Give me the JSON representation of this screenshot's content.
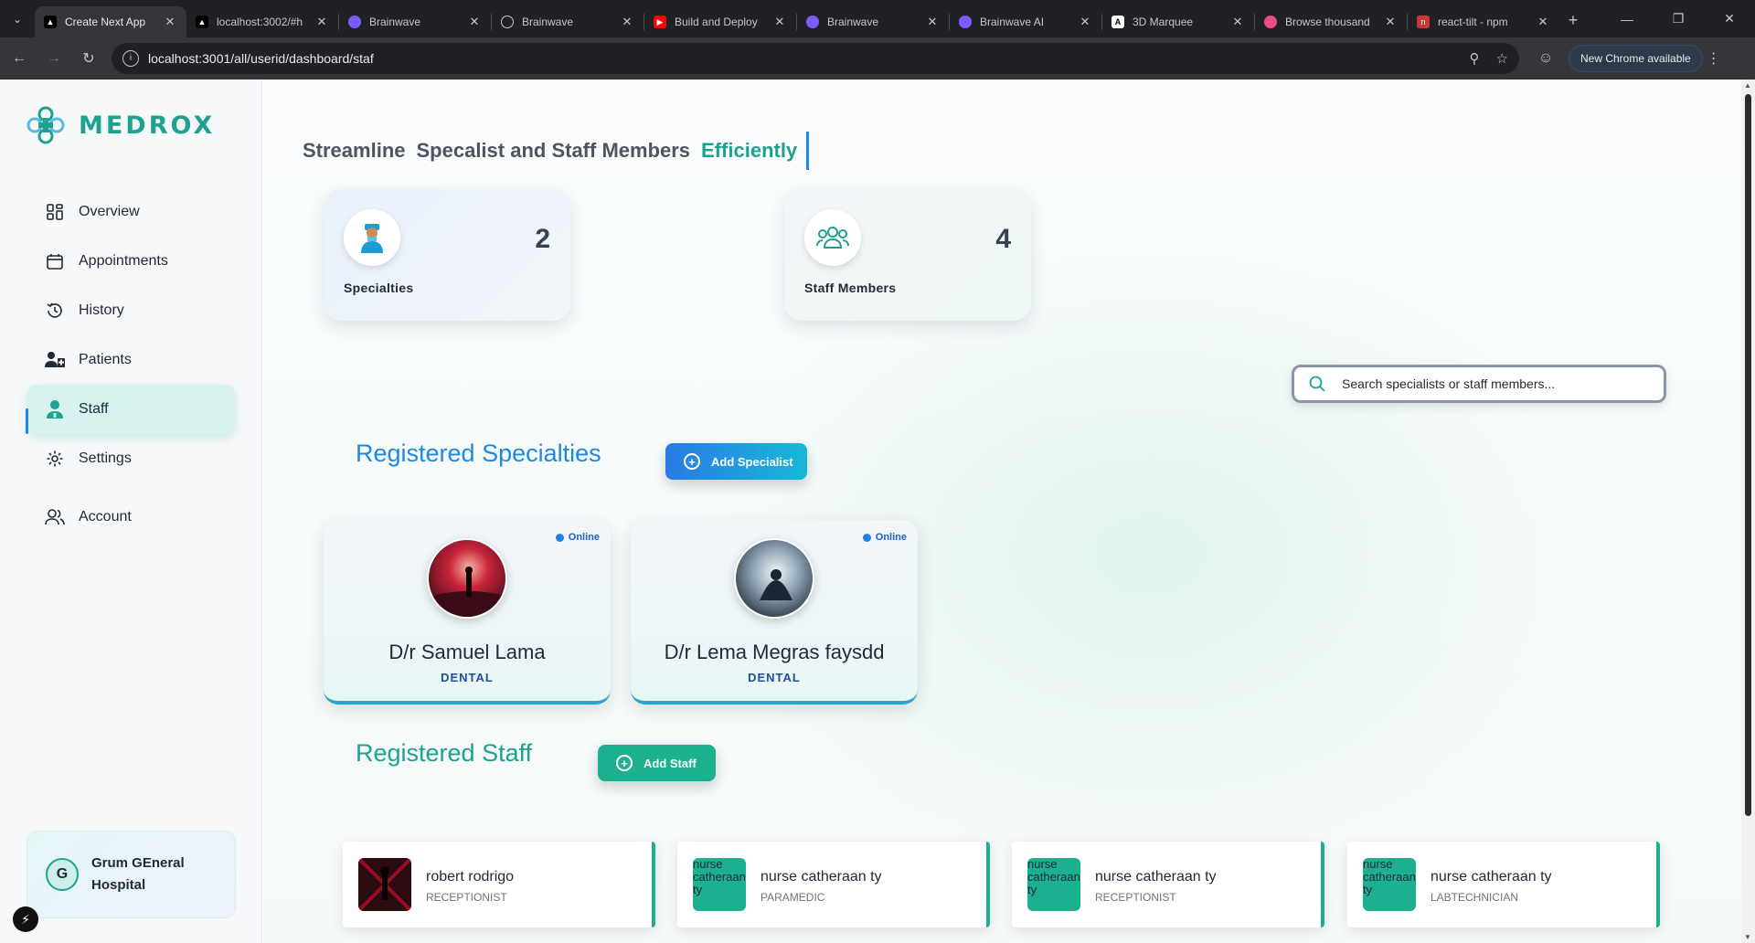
{
  "browser": {
    "tabs": [
      {
        "title": "Create Next App",
        "icon": "nextjs-icon",
        "color": "#000000",
        "active": true
      },
      {
        "title": "localhost:3002/#h",
        "icon": "nextjs-icon",
        "color": "#000000"
      },
      {
        "title": "Brainwave",
        "icon": "brainwave-icon",
        "color": "#7c5cff"
      },
      {
        "title": "Brainwave",
        "icon": "globe-icon",
        "color": "#5f6368"
      },
      {
        "title": "Build and Deploy",
        "icon": "youtube-icon",
        "color": "#ff0000"
      },
      {
        "title": "Brainwave",
        "icon": "brainwave-icon",
        "color": "#7c5cff"
      },
      {
        "title": "Brainwave AI",
        "icon": "brainwave-icon",
        "color": "#7c5cff"
      },
      {
        "title": "3D Marquee",
        "icon": "aceternity-icon",
        "color": "#000000"
      },
      {
        "title": "Browse thousand",
        "icon": "dribbble-icon",
        "color": "#ea4c89"
      },
      {
        "title": "react-tilt - npm",
        "icon": "npm-icon",
        "color": "#cb3837"
      }
    ],
    "url": "localhost:3001/all/userid/dashboard/staf",
    "update_label": "New Chrome available"
  },
  "sidebar": {
    "brand": "MEDROX",
    "items": [
      {
        "label": "Overview",
        "icon": "grid-icon"
      },
      {
        "label": "Appointments",
        "icon": "calendar-icon"
      },
      {
        "label": "History",
        "icon": "history-icon"
      },
      {
        "label": "Patients",
        "icon": "patients-icon"
      },
      {
        "label": "Staff",
        "icon": "staff-icon",
        "active": true
      },
      {
        "label": "Settings",
        "icon": "gear-icon"
      },
      {
        "label": "Account",
        "icon": "users-icon"
      }
    ],
    "hospital": {
      "initial": "G",
      "name": "Grum GEneral Hospital"
    }
  },
  "main": {
    "headline": {
      "part1": "Streamline",
      "part2": "Specalist and Staff Members",
      "highlight": "Efficiently"
    },
    "stats": [
      {
        "label": "Specialties",
        "value": "2",
        "icon": "doctor-icon"
      },
      {
        "label": "Staff Members",
        "value": "4",
        "icon": "group-icon"
      }
    ],
    "search": {
      "placeholder": "Search specialists or staff members..."
    },
    "specialties_title": "Registered Specialties",
    "add_specialist_label": "Add Specialist",
    "specialists": [
      {
        "name": "D/r Samuel Lama",
        "department": "DENTAL",
        "status": "Online"
      },
      {
        "name": "D/r Lema Megras faysdd",
        "department": "DENTAL",
        "status": "Online"
      }
    ],
    "staff_title": "Registered Staff",
    "add_staff_label": "Add Staff",
    "staff": [
      {
        "name": "robert rodrigo",
        "role": "RECEPTIONIST",
        "alt": ""
      },
      {
        "name": "nurse catheraan ty",
        "role": "PARAMEDIC",
        "alt": "nurse catheraan ty"
      },
      {
        "name": "nurse catheraan ty",
        "role": "RECEPTIONIST",
        "alt": "nurse catheraan ty"
      },
      {
        "name": "nurse catheraan ty",
        "role": "LABTECHNICIAN",
        "alt": "nurse catheraan ty"
      }
    ]
  },
  "colors": {
    "brand": "#1ca28f",
    "accent": "#1e88e5",
    "online": "#2a7be4"
  }
}
